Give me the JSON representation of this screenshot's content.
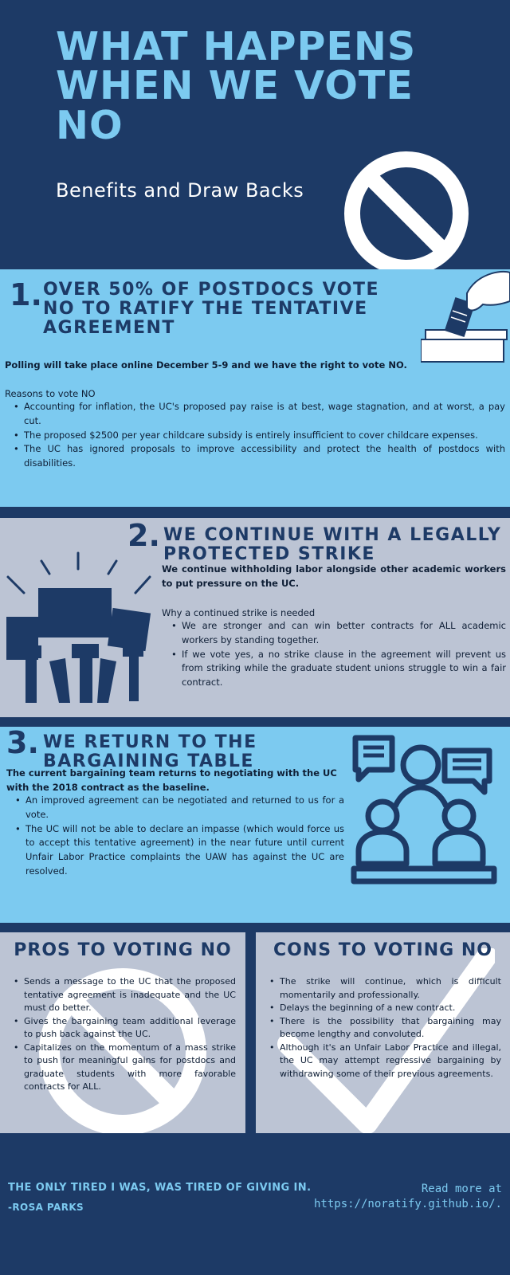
{
  "header": {
    "title": "WHAT HAPPENS WHEN WE VOTE NO",
    "subtitle": "Benefits and Draw Backs",
    "icon": "prohibited-icon"
  },
  "section1": {
    "number": "1.",
    "title": "OVER 50% OF POSTDOCS VOTE NO TO RATIFY THE TENTATIVE AGREEMENT",
    "icon": "ballot-box-icon",
    "lead": "Polling will take place online December 5-9 and we have the right to vote NO.",
    "list_heading": "Reasons to vote NO",
    "items": [
      "Accounting for inflation, the UC's proposed pay raise is at best, wage stagnation, and at worst, a pay cut.",
      "The proposed $2500 per year childcare subsidy is entirely insufficient to cover childcare expenses.",
      "The UC has ignored proposals to improve accessibility and protect the health of postdocs with disabilities."
    ]
  },
  "section2": {
    "number": "2.",
    "title": "WE CONTINUE WITH A LEGALLY PROTECTED STRIKE",
    "icon": "protest-fists-icon",
    "lead": "We continue withholding labor alongside other academic workers to put pressure on the UC.",
    "list_heading": "Why a continued strike is needed",
    "items": [
      "We are stronger and can win better contracts for ALL academic workers by standing together.",
      "If we vote yes, a no strike clause in the agreement will prevent us from striking while the graduate student unions struggle to win a fair contract."
    ]
  },
  "section3": {
    "number": "3.",
    "title": "WE RETURN TO THE BARGAINING TABLE",
    "icon": "meeting-people-icon",
    "lead": "The current bargaining team returns to negotiating with the UC with the 2018 contract as the baseline.",
    "items": [
      "An improved agreement can be negotiated and returned to us for a vote.",
      "The UC will not be able to declare an impasse (which would force us to accept this tentative agreement) in the near future until current Unfair Labor Practice complaints the UAW has against the UC are resolved."
    ]
  },
  "pros": {
    "title": "PROS TO VOTING NO",
    "items": [
      "Sends a message to the UC that the proposed tentative agreement is inadequate and the UC must do better.",
      "Gives the bargaining team additional leverage to push back against the UC.",
      "Capitalizes on the momentum of a mass strike to push for meaningful gains for postdocs and graduate students with more favorable contracts for ALL."
    ]
  },
  "cons": {
    "title": "CONS TO VOTING NO",
    "items": [
      "The strike will continue, which is difficult momentarily and professionally.",
      "Delays the beginning of a new contract.",
      "There is the possibility that bargaining may become lengthy and convoluted.",
      "Although it's an Unfair Labor Practice and illegal, the UC may attempt regressive bargaining by withdrawing some of their previous agreements."
    ]
  },
  "footer": {
    "quote": "THE ONLY TIRED I WAS, WAS TIRED OF GIVING IN.",
    "author": "-ROSA PARKS",
    "more_label": "Read more at",
    "more_url": "https://noratify.github.io/."
  },
  "colors": {
    "navy": "#1d3a66",
    "light_blue": "#7ccaf0",
    "gray": "#bcc4d4"
  }
}
